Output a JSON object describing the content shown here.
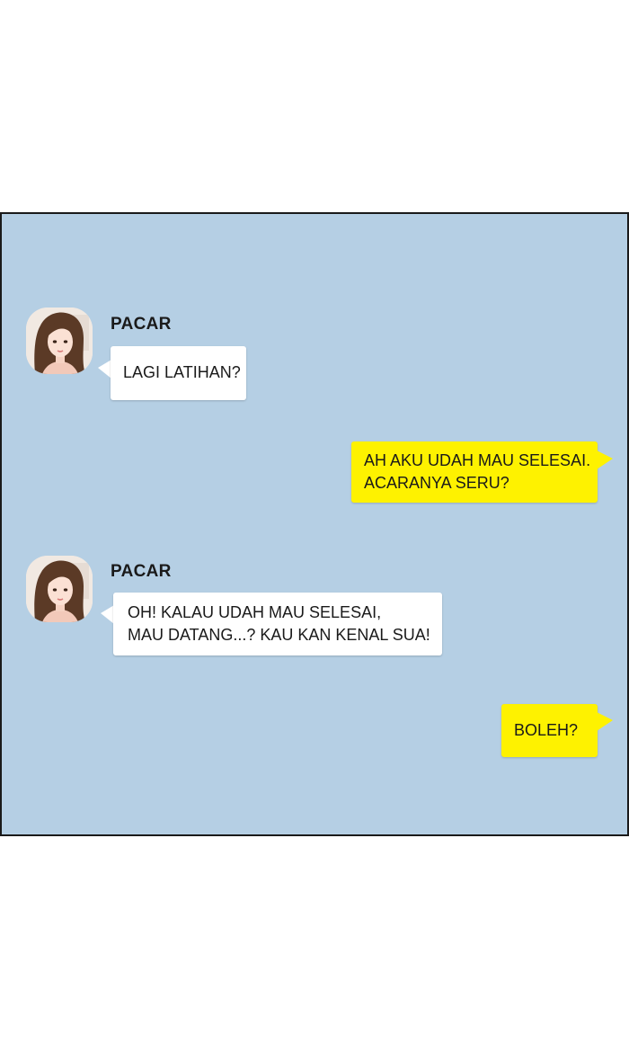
{
  "messages": [
    {
      "side": "in",
      "sender": "PACAR",
      "lines": [
        "LAGI LATIHAN?"
      ]
    },
    {
      "side": "out",
      "lines": [
        "AH AKU UDAH MAU SELESAI.",
        "ACARANYA SERU?"
      ]
    },
    {
      "side": "in",
      "sender": "PACAR",
      "lines": [
        "OH! KALAU UDAH MAU SELESAI,",
        "MAU DATANG...? KAU KAN KENAL SUA!"
      ]
    },
    {
      "side": "out",
      "lines": [
        "BOLEH?"
      ]
    }
  ],
  "colors": {
    "panel_background": "#b5cfe4",
    "incoming_bubble": "#ffffff",
    "outgoing_bubble": "#fef200",
    "panel_border": "#1a1a1a"
  },
  "icons": {
    "avatar": "woman-portrait-avatar"
  }
}
